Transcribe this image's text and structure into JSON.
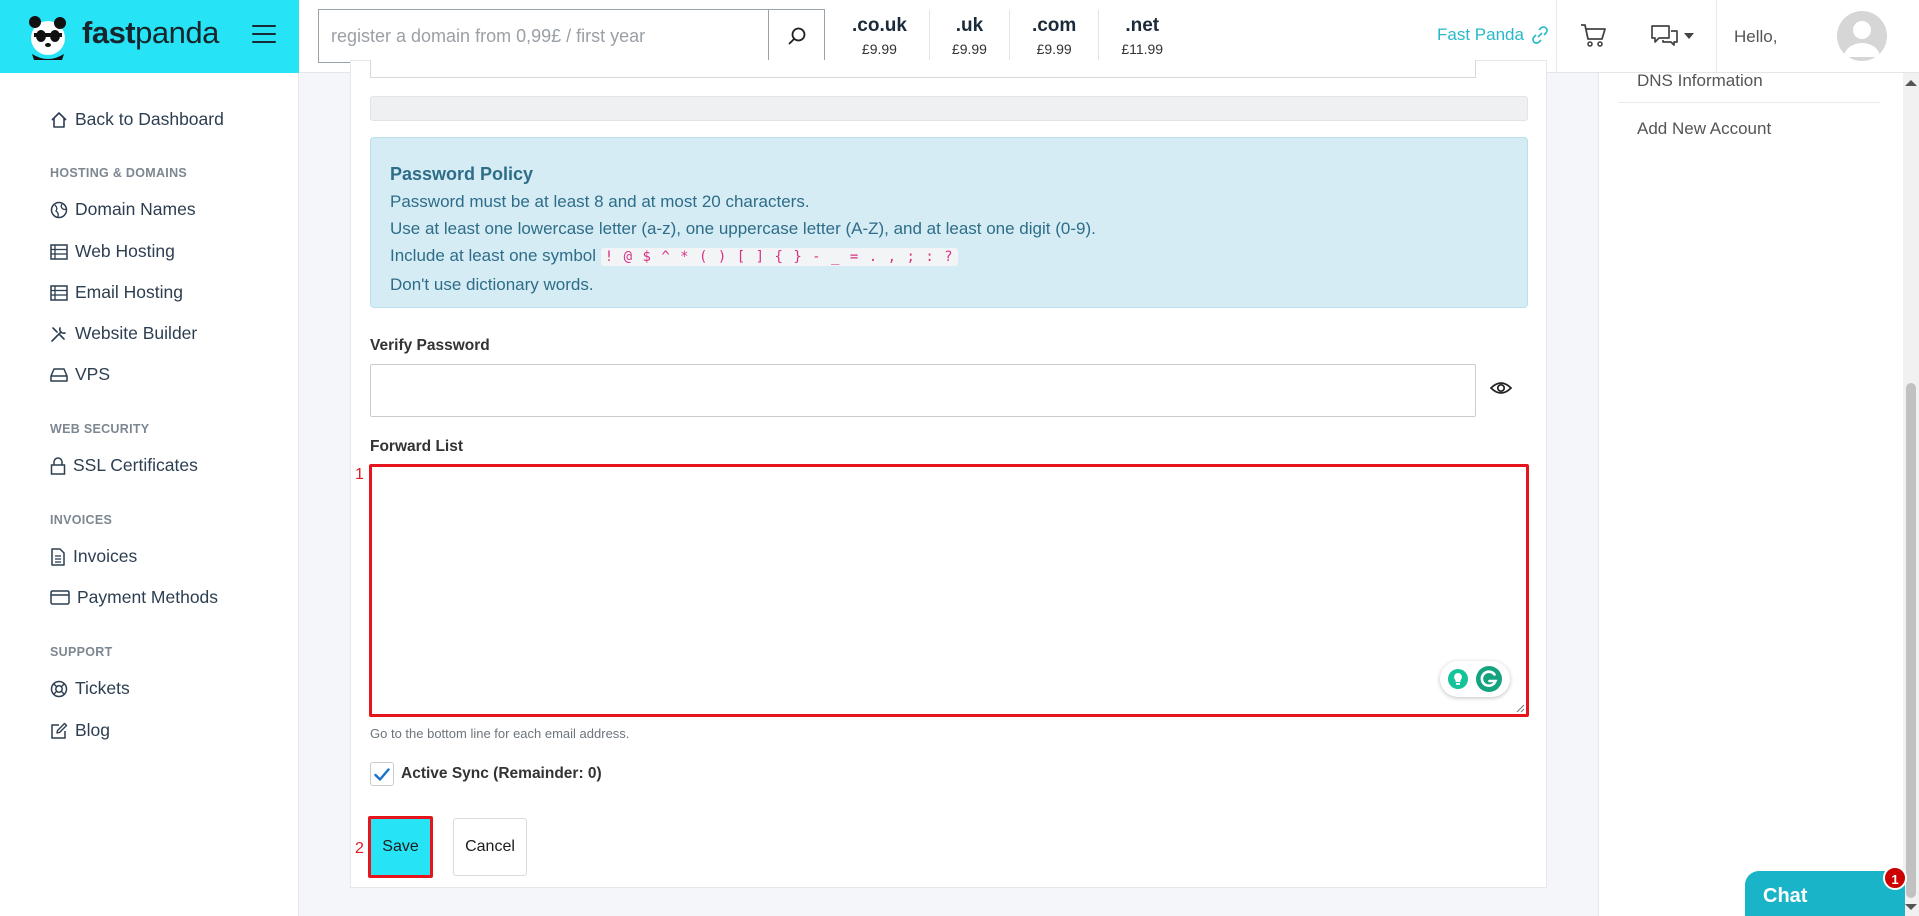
{
  "brand": {
    "name_bold": "fast",
    "name_light": "panda"
  },
  "search": {
    "placeholder": "register a domain from 0,99£ / first year",
    "value": ""
  },
  "tlds": [
    {
      "ext": ".co.uk",
      "price": "£9.99"
    },
    {
      "ext": ".uk",
      "price": "£9.99"
    },
    {
      "ext": ".com",
      "price": "£9.99"
    },
    {
      "ext": ".net",
      "price": "£11.99"
    }
  ],
  "header": {
    "fastpanda_link": "Fast Panda",
    "greeting": "Hello,"
  },
  "sidebar": {
    "back": "Back to Dashboard",
    "sections": [
      {
        "heading": "HOSTING & DOMAINS",
        "items": [
          "Domain Names",
          "Web Hosting",
          "Email Hosting",
          "Website Builder",
          "VPS"
        ]
      },
      {
        "heading": "WEB SECURITY",
        "items": [
          "SSL Certificates"
        ]
      },
      {
        "heading": "INVOICES",
        "items": [
          "Invoices",
          "Payment Methods"
        ]
      },
      {
        "heading": "SUPPORT",
        "items": [
          "Tickets",
          "Blog"
        ]
      }
    ]
  },
  "policy": {
    "title": "Password Policy",
    "line1": "Password must be at least 8 and at most 20 characters.",
    "line2": "Use at least one lowercase letter (a-z), one uppercase letter (A-Z), and at least one digit (0-9).",
    "line3_prefix": "Include at least one symbol",
    "symbols": "! @ $ ^ * ( ) [ ] { } - _ = . , ; : ?",
    "line4": "Don't use dictionary words."
  },
  "form": {
    "verify_label": "Verify Password",
    "verify_value": "",
    "forward_label": "Forward List",
    "forward_value": "",
    "forward_hint": "Go to the bottom line for each email address.",
    "sync_label": "Active Sync (Remainder: 0)",
    "sync_checked": true,
    "save": "Save",
    "cancel": "Cancel"
  },
  "markers": {
    "forward": "1",
    "save": "2"
  },
  "right_panel": {
    "links": [
      "DNS Information",
      "Add New Account"
    ]
  },
  "chat": {
    "label": "Chat",
    "badge": "1"
  },
  "colors": {
    "brand_cyan": "#27e3f6",
    "link_teal": "#27b9c9",
    "highlight_red": "#e6141c"
  }
}
